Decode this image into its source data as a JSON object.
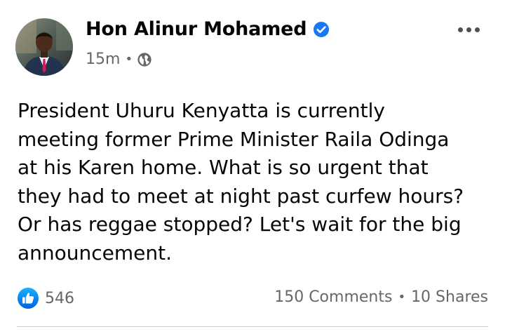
{
  "post": {
    "author": {
      "name": "Hon Alinur Mohamed",
      "verified": true
    },
    "meta": {
      "time": "15m",
      "separator": "•",
      "audience_icon": "globe-icon"
    },
    "text": "President Uhuru Kenyatta is currently\nmeeting former Prime Minister Raila Odinga\nat his Karen home. What is so urgent that\nthey had to meet at night past curfew hours?\nOr has reggae stopped? Let's wait for the big\nannouncement.",
    "reactions": {
      "icon": "like-icon",
      "count": "546"
    },
    "engagement": {
      "comments": "150 Comments",
      "separator": "•",
      "shares": "10 Shares"
    }
  },
  "colors": {
    "brand_blue": "#1877f2",
    "secondary_text": "#65676b",
    "primary_text": "#050505"
  }
}
